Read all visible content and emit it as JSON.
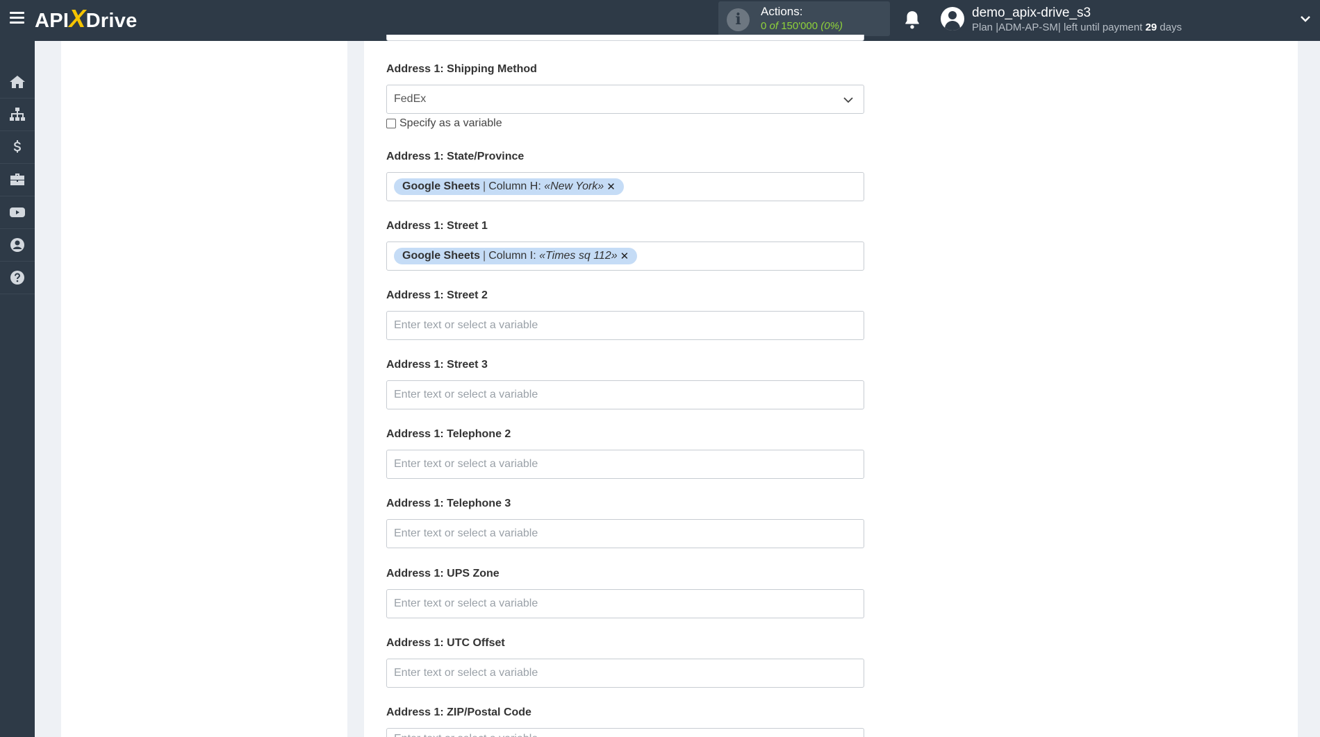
{
  "header": {
    "logo_prefix": "API",
    "logo_x": "X",
    "logo_suffix": "Drive",
    "actions_label": "Actions:",
    "actions_used": "0",
    "actions_of": "of",
    "actions_total": "150'000",
    "actions_percent": "(0%)",
    "username": "demo_apix-drive_s3",
    "plan_prefix": "Plan |ADM-AP-SM| left until payment",
    "plan_days": "29",
    "plan_suffix": "days"
  },
  "sidebar": {
    "items": [
      "home-icon",
      "sitemap-icon",
      "dollar-icon",
      "briefcase-icon",
      "youtube-icon",
      "user-circle-icon",
      "help-icon"
    ]
  },
  "form": {
    "shipping_method": {
      "label": "Address 1: Shipping Method",
      "value": "FedEx",
      "checkbox_label": "Specify as a variable"
    },
    "state": {
      "label": "Address 1: State/Province",
      "tag_source": "Google Sheets",
      "tag_sep": "|",
      "tag_column": "Column H:",
      "tag_value": "«New York»"
    },
    "street1": {
      "label": "Address 1: Street 1",
      "tag_source": "Google Sheets",
      "tag_sep": "|",
      "tag_column": "Column I:",
      "tag_value": "«Times sq 112»"
    },
    "placeholder": "Enter text or select a variable",
    "street2_label": "Address 1: Street 2",
    "street3_label": "Address 1: Street 3",
    "telephone2_label": "Address 1: Telephone 2",
    "telephone3_label": "Address 1: Telephone 3",
    "ups_zone_label": "Address 1: UPS Zone",
    "utc_offset_label": "Address 1: UTC Offset",
    "zip_label": "Address 1: ZIP/Postal Code"
  }
}
